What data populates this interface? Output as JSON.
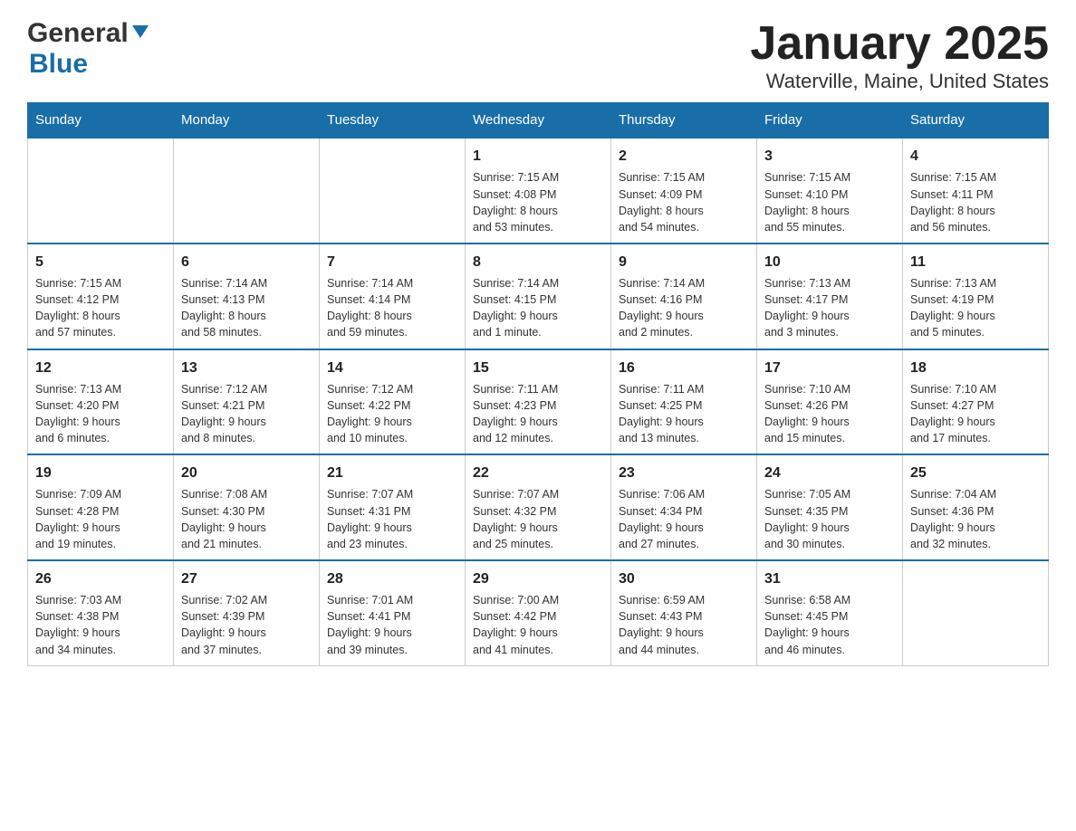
{
  "header": {
    "logo_text1": "General",
    "logo_text2": "Blue",
    "title": "January 2025",
    "subtitle": "Waterville, Maine, United States"
  },
  "days_of_week": [
    "Sunday",
    "Monday",
    "Tuesday",
    "Wednesday",
    "Thursday",
    "Friday",
    "Saturday"
  ],
  "weeks": [
    [
      {
        "day": "",
        "info": ""
      },
      {
        "day": "",
        "info": ""
      },
      {
        "day": "",
        "info": ""
      },
      {
        "day": "1",
        "info": "Sunrise: 7:15 AM\nSunset: 4:08 PM\nDaylight: 8 hours\nand 53 minutes."
      },
      {
        "day": "2",
        "info": "Sunrise: 7:15 AM\nSunset: 4:09 PM\nDaylight: 8 hours\nand 54 minutes."
      },
      {
        "day": "3",
        "info": "Sunrise: 7:15 AM\nSunset: 4:10 PM\nDaylight: 8 hours\nand 55 minutes."
      },
      {
        "day": "4",
        "info": "Sunrise: 7:15 AM\nSunset: 4:11 PM\nDaylight: 8 hours\nand 56 minutes."
      }
    ],
    [
      {
        "day": "5",
        "info": "Sunrise: 7:15 AM\nSunset: 4:12 PM\nDaylight: 8 hours\nand 57 minutes."
      },
      {
        "day": "6",
        "info": "Sunrise: 7:14 AM\nSunset: 4:13 PM\nDaylight: 8 hours\nand 58 minutes."
      },
      {
        "day": "7",
        "info": "Sunrise: 7:14 AM\nSunset: 4:14 PM\nDaylight: 8 hours\nand 59 minutes."
      },
      {
        "day": "8",
        "info": "Sunrise: 7:14 AM\nSunset: 4:15 PM\nDaylight: 9 hours\nand 1 minute."
      },
      {
        "day": "9",
        "info": "Sunrise: 7:14 AM\nSunset: 4:16 PM\nDaylight: 9 hours\nand 2 minutes."
      },
      {
        "day": "10",
        "info": "Sunrise: 7:13 AM\nSunset: 4:17 PM\nDaylight: 9 hours\nand 3 minutes."
      },
      {
        "day": "11",
        "info": "Sunrise: 7:13 AM\nSunset: 4:19 PM\nDaylight: 9 hours\nand 5 minutes."
      }
    ],
    [
      {
        "day": "12",
        "info": "Sunrise: 7:13 AM\nSunset: 4:20 PM\nDaylight: 9 hours\nand 6 minutes."
      },
      {
        "day": "13",
        "info": "Sunrise: 7:12 AM\nSunset: 4:21 PM\nDaylight: 9 hours\nand 8 minutes."
      },
      {
        "day": "14",
        "info": "Sunrise: 7:12 AM\nSunset: 4:22 PM\nDaylight: 9 hours\nand 10 minutes."
      },
      {
        "day": "15",
        "info": "Sunrise: 7:11 AM\nSunset: 4:23 PM\nDaylight: 9 hours\nand 12 minutes."
      },
      {
        "day": "16",
        "info": "Sunrise: 7:11 AM\nSunset: 4:25 PM\nDaylight: 9 hours\nand 13 minutes."
      },
      {
        "day": "17",
        "info": "Sunrise: 7:10 AM\nSunset: 4:26 PM\nDaylight: 9 hours\nand 15 minutes."
      },
      {
        "day": "18",
        "info": "Sunrise: 7:10 AM\nSunset: 4:27 PM\nDaylight: 9 hours\nand 17 minutes."
      }
    ],
    [
      {
        "day": "19",
        "info": "Sunrise: 7:09 AM\nSunset: 4:28 PM\nDaylight: 9 hours\nand 19 minutes."
      },
      {
        "day": "20",
        "info": "Sunrise: 7:08 AM\nSunset: 4:30 PM\nDaylight: 9 hours\nand 21 minutes."
      },
      {
        "day": "21",
        "info": "Sunrise: 7:07 AM\nSunset: 4:31 PM\nDaylight: 9 hours\nand 23 minutes."
      },
      {
        "day": "22",
        "info": "Sunrise: 7:07 AM\nSunset: 4:32 PM\nDaylight: 9 hours\nand 25 minutes."
      },
      {
        "day": "23",
        "info": "Sunrise: 7:06 AM\nSunset: 4:34 PM\nDaylight: 9 hours\nand 27 minutes."
      },
      {
        "day": "24",
        "info": "Sunrise: 7:05 AM\nSunset: 4:35 PM\nDaylight: 9 hours\nand 30 minutes."
      },
      {
        "day": "25",
        "info": "Sunrise: 7:04 AM\nSunset: 4:36 PM\nDaylight: 9 hours\nand 32 minutes."
      }
    ],
    [
      {
        "day": "26",
        "info": "Sunrise: 7:03 AM\nSunset: 4:38 PM\nDaylight: 9 hours\nand 34 minutes."
      },
      {
        "day": "27",
        "info": "Sunrise: 7:02 AM\nSunset: 4:39 PM\nDaylight: 9 hours\nand 37 minutes."
      },
      {
        "day": "28",
        "info": "Sunrise: 7:01 AM\nSunset: 4:41 PM\nDaylight: 9 hours\nand 39 minutes."
      },
      {
        "day": "29",
        "info": "Sunrise: 7:00 AM\nSunset: 4:42 PM\nDaylight: 9 hours\nand 41 minutes."
      },
      {
        "day": "30",
        "info": "Sunrise: 6:59 AM\nSunset: 4:43 PM\nDaylight: 9 hours\nand 44 minutes."
      },
      {
        "day": "31",
        "info": "Sunrise: 6:58 AM\nSunset: 4:45 PM\nDaylight: 9 hours\nand 46 minutes."
      },
      {
        "day": "",
        "info": ""
      }
    ]
  ]
}
